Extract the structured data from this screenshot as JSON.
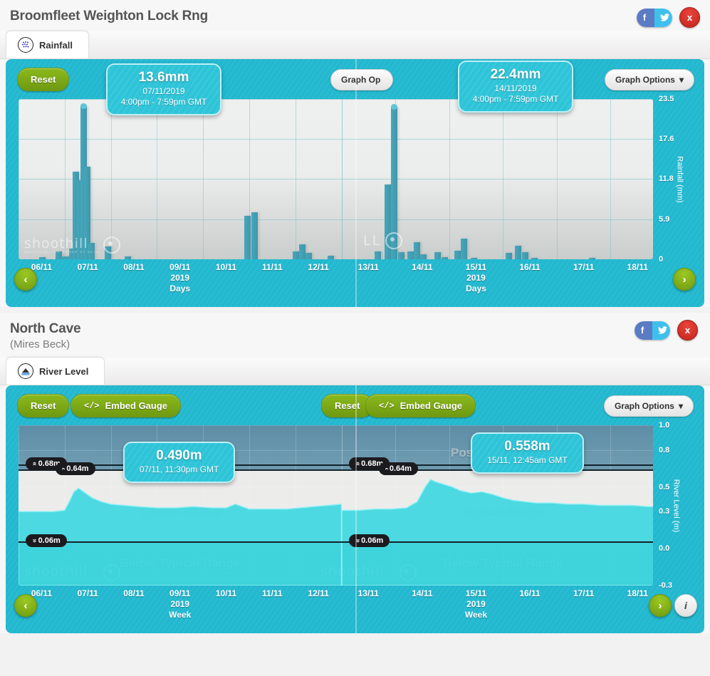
{
  "rainfall_station": {
    "title": "Broomfleet Weighton Lock Rng",
    "tab": {
      "label": "Rainfall",
      "icon": "rainfall-icon"
    },
    "share": {
      "facebook": "f",
      "twitter": "t",
      "close": "x"
    },
    "controls": {
      "reset": "Reset",
      "graph_options_left": "Graph Op",
      "graph_options_right": "Graph Options",
      "caret": "▾"
    },
    "tooltip_left": {
      "value": "13.6mm",
      "date": "07/11/2019",
      "time": "4:00pm - 7:59pm GMT"
    },
    "tooltip_right": {
      "value": "22.4mm",
      "date": "14/11/2019",
      "time": "4:00pm - 7:59pm GMT"
    },
    "nav": {
      "prev": "‹",
      "next": "›"
    },
    "watermark": {
      "name": "shoothill",
      "tagline": "UNLOCKING THE POWER OF DATA"
    }
  },
  "river_station": {
    "title": "North Cave",
    "subtitle": "(Mires Beck)",
    "tab": {
      "label": "River Level",
      "icon": "river-level-icon"
    },
    "share": {
      "facebook": "f",
      "twitter": "t",
      "close": "x"
    },
    "controls": {
      "reset": "Reset",
      "embed_gauge": "Embed Gauge",
      "embed_icon": "</>",
      "graph_options": "Graph Options",
      "caret": "▾"
    },
    "tooltip_left": {
      "value": "0.490m",
      "datetime": "07/11, 11:30pm GMT"
    },
    "tooltip_right": {
      "value": "0.558m",
      "datetime": "15/11, 12:45am GMT"
    },
    "bands": {
      "flood": "Possible Flooding",
      "typical": "Typical Range",
      "below": "Below Typical Range"
    },
    "thresholds": {
      "high": "0.68m",
      "mid": "0.64m",
      "low": "0.06m"
    },
    "nav": {
      "prev": "‹",
      "next": "›",
      "info": "i"
    },
    "watermark": {
      "name": "shoothill",
      "tagline": "UNLOCKING THE POWER OF DATA"
    }
  },
  "chart_data": [
    {
      "type": "bar",
      "id": "rainfall-left",
      "title": "Rainfall",
      "xlabel": "2019 Days",
      "ylabel": "Rainfall (mm)",
      "yticks": [
        "0",
        "5.9",
        "11.8",
        "17.6",
        "23.5"
      ],
      "ylim": [
        0,
        23.5
      ],
      "categories": [
        "06/11",
        "07/11",
        "08/11",
        "09/11",
        "10/11",
        "11/11",
        "12/11"
      ],
      "axis_sub": {
        "label_at": "09/11",
        "year": "2019",
        "unit": "Days"
      },
      "bars": [
        {
          "x": 0.3,
          "v": 0.0
        },
        {
          "x": 0.45,
          "v": 0.3
        },
        {
          "x": 0.62,
          "v": 0.0
        },
        {
          "x": 0.8,
          "v": 1.2
        },
        {
          "x": 0.92,
          "v": 0.4
        },
        {
          "x": 1.02,
          "v": 0.4
        },
        {
          "x": 1.1,
          "v": 1.6
        },
        {
          "x": 1.18,
          "v": 12.8
        },
        {
          "x": 1.26,
          "v": 11.6
        },
        {
          "x": 1.34,
          "v": 22.5
        },
        {
          "x": 1.42,
          "v": 13.6
        },
        {
          "x": 1.52,
          "v": 2.4
        },
        {
          "x": 1.7,
          "v": 0.0
        },
        {
          "x": 1.86,
          "v": 1.9
        },
        {
          "x": 2.3,
          "v": 0.4
        },
        {
          "x": 2.75,
          "v": 0.0
        },
        {
          "x": 4.9,
          "v": 6.4
        },
        {
          "x": 5.05,
          "v": 6.9
        },
        {
          "x": 5.95,
          "v": 1.2
        },
        {
          "x": 6.08,
          "v": 2.2
        },
        {
          "x": 6.22,
          "v": 0.9
        },
        {
          "x": 6.7,
          "v": 0.5
        }
      ]
    },
    {
      "type": "bar",
      "id": "rainfall-right",
      "title": "Rainfall",
      "xlabel": "2019 Days",
      "ylabel": "Rainfall (mm)",
      "yticks": [
        "0",
        "5.9",
        "11.8",
        "17.6",
        "23.5"
      ],
      "ylim": [
        0,
        23.5
      ],
      "categories": [
        "13/11",
        "14/11",
        "15/11",
        "16/11",
        "17/11",
        "18/11"
      ],
      "axis_sub": {
        "label_at": "15/11",
        "year": "2019",
        "unit": "Days"
      },
      "bars": [
        {
          "x": 0.62,
          "v": 1.1
        },
        {
          "x": 0.8,
          "v": 11.0
        },
        {
          "x": 0.92,
          "v": 22.4
        },
        {
          "x": 1.05,
          "v": 1.0
        },
        {
          "x": 1.22,
          "v": 1.2
        },
        {
          "x": 1.34,
          "v": 2.5
        },
        {
          "x": 1.46,
          "v": 0.7
        },
        {
          "x": 1.72,
          "v": 1.0
        },
        {
          "x": 1.86,
          "v": 0.3
        },
        {
          "x": 2.1,
          "v": 1.3
        },
        {
          "x": 2.22,
          "v": 3.0
        },
        {
          "x": 2.4,
          "v": 0.2
        },
        {
          "x": 3.05,
          "v": 0.9
        },
        {
          "x": 3.22,
          "v": 2.0
        },
        {
          "x": 3.36,
          "v": 1.0
        },
        {
          "x": 3.52,
          "v": 0.1
        },
        {
          "x": 4.6,
          "v": 0.2
        }
      ]
    },
    {
      "type": "area",
      "id": "river-left",
      "title": "River Level",
      "xlabel": "2019 Week",
      "ylabel": "River Level (m)",
      "yticks": [
        "-0.3",
        "0.0",
        "0.3",
        "0.5",
        "0.8",
        "1.0"
      ],
      "ylim": [
        -0.3,
        1.0
      ],
      "categories": [
        "06/11",
        "07/11",
        "08/11",
        "09/11",
        "10/11",
        "11/11",
        "12/11"
      ],
      "axis_sub": {
        "label_at": "09/11",
        "year": "2019",
        "unit": "Week"
      },
      "thresholds": {
        "possible_flooding": 0.68,
        "high": 0.64,
        "low": 0.06
      },
      "x": [
        0.0,
        0.25,
        0.5,
        0.75,
        1.0,
        1.1,
        1.2,
        1.3,
        1.45,
        1.6,
        1.8,
        2.0,
        2.3,
        2.6,
        3.0,
        3.4,
        3.8,
        4.2,
        4.5,
        4.7,
        4.85,
        5.0,
        5.2,
        5.5,
        5.8,
        6.1,
        6.4,
        6.7,
        7.0
      ],
      "y": [
        0.3,
        0.3,
        0.3,
        0.3,
        0.31,
        0.38,
        0.46,
        0.49,
        0.45,
        0.41,
        0.38,
        0.36,
        0.35,
        0.34,
        0.33,
        0.33,
        0.34,
        0.33,
        0.33,
        0.36,
        0.34,
        0.32,
        0.32,
        0.32,
        0.32,
        0.33,
        0.34,
        0.35,
        0.36
      ]
    },
    {
      "type": "area",
      "id": "river-right",
      "title": "River Level",
      "xlabel": "2019 Week",
      "ylabel": "River Level (m)",
      "yticks": [
        "-0.3",
        "0.0",
        "0.3",
        "0.5",
        "0.8",
        "1.0"
      ],
      "ylim": [
        -0.3,
        1.0
      ],
      "categories": [
        "13/11",
        "14/11",
        "15/11",
        "16/11",
        "17/11",
        "18/11"
      ],
      "axis_sub": {
        "label_at": "15/11",
        "year": "2019",
        "unit": "Week"
      },
      "thresholds": {
        "possible_flooding": 0.68,
        "high": 0.64,
        "low": 0.06
      },
      "x": [
        0.0,
        0.3,
        0.6,
        0.9,
        1.2,
        1.4,
        1.55,
        1.65,
        1.75,
        1.9,
        2.05,
        2.2,
        2.4,
        2.6,
        2.8,
        3.0,
        3.2,
        3.4,
        3.6,
        3.9,
        4.2,
        4.5,
        4.8,
        5.1,
        5.4,
        5.7,
        6.0
      ],
      "y": [
        0.31,
        0.31,
        0.32,
        0.32,
        0.33,
        0.38,
        0.5,
        0.56,
        0.54,
        0.52,
        0.5,
        0.47,
        0.45,
        0.46,
        0.44,
        0.41,
        0.39,
        0.38,
        0.37,
        0.37,
        0.36,
        0.36,
        0.35,
        0.35,
        0.35,
        0.34,
        0.34
      ]
    }
  ]
}
